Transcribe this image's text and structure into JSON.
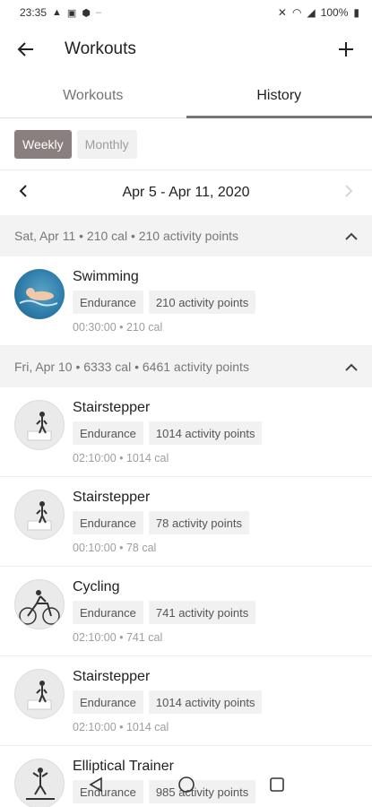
{
  "status_bar": {
    "time": "23:35",
    "battery": "100%"
  },
  "app_bar": {
    "title": "Workouts"
  },
  "tabs": [
    {
      "label": "Workouts",
      "active": false
    },
    {
      "label": "History",
      "active": true
    }
  ],
  "filters": {
    "weekly": "Weekly",
    "monthly": "Monthly",
    "selected": "Weekly"
  },
  "date_nav": {
    "range": "Apr 5 - Apr 11, 2020"
  },
  "days": [
    {
      "header": "Sat, Apr 11 • 210 cal • 210 activity points",
      "workouts": [
        {
          "name": "Swimming",
          "category": "Endurance",
          "points": "210 activity points",
          "meta": "00:30:00 • 210 cal",
          "icon": "swimmer-icon"
        }
      ]
    },
    {
      "header": "Fri, Apr 10 • 6333 cal • 6461 activity points",
      "workouts": [
        {
          "name": "Stairstepper",
          "category": "Endurance",
          "points": "1014 activity points",
          "meta": "02:10:00 • 1014 cal",
          "icon": "stairstepper-icon"
        },
        {
          "name": "Stairstepper",
          "category": "Endurance",
          "points": "78 activity points",
          "meta": "00:10:00 • 78 cal",
          "icon": "stairstepper-icon"
        },
        {
          "name": "Cycling",
          "category": "Endurance",
          "points": "741 activity points",
          "meta": "02:10:00 • 741 cal",
          "icon": "cyclist-icon"
        },
        {
          "name": "Stairstepper",
          "category": "Endurance",
          "points": "1014 activity points",
          "meta": "02:10:00 • 1014 cal",
          "icon": "stairstepper-icon"
        },
        {
          "name": "Elliptical Trainer",
          "category": "Endurance",
          "points": "985 activity points",
          "meta": "",
          "icon": "elliptical-icon"
        }
      ]
    }
  ]
}
